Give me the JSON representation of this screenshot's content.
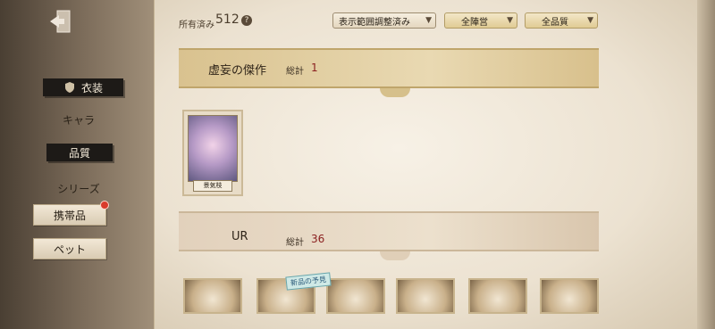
{
  "sidebar": {
    "items": [
      {
        "label": "衣装",
        "active": true
      },
      {
        "label": "キャラ"
      },
      {
        "label": "品質",
        "active": true
      },
      {
        "label": "シリーズ"
      },
      {
        "label": "携帯品",
        "badge": true
      },
      {
        "label": "ペット"
      }
    ]
  },
  "header": {
    "owned_label": "所有済み",
    "owned_count": "512",
    "help_glyph": "?",
    "filter_display": "表示範囲調整済み",
    "filter_faction": "全陣営",
    "filter_quality": "全品質"
  },
  "sections": [
    {
      "title": "虚妄の傑作",
      "total_label": "総計",
      "total": "1"
    },
    {
      "title": "UR",
      "total_label": "総計",
      "total": "36"
    }
  ],
  "featured_card": {
    "label": "景気枝"
  },
  "thumb_sticker": "新品の予見",
  "icons": {
    "exit": "exit-door-icon",
    "help": "help-icon",
    "chevron": "chevron-down-icon",
    "shield": "shield-icon"
  },
  "colors": {
    "accent_gold": "#d9c28f",
    "total_red": "#8a1f1f",
    "badge_red": "#d93a2b"
  }
}
